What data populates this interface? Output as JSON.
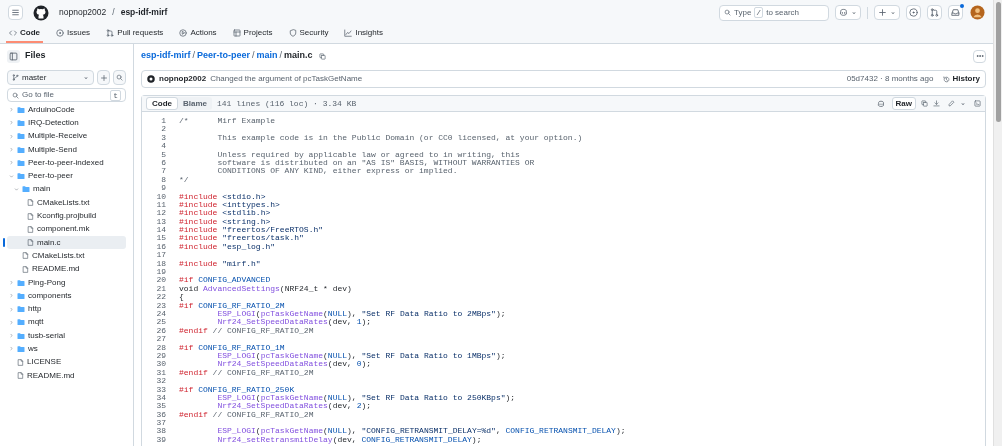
{
  "header": {
    "owner": "nopnop2002",
    "separator": "/",
    "repo": "esp-idf-mirf",
    "search": {
      "placeholder_before": "Type",
      "key": "/",
      "placeholder_after": "to search"
    },
    "inbox_unread": true
  },
  "tabs": [
    {
      "label": "Code",
      "selected": true
    },
    {
      "label": "Issues",
      "selected": false
    },
    {
      "label": "Pull requests",
      "selected": false
    },
    {
      "label": "Actions",
      "selected": false
    },
    {
      "label": "Projects",
      "selected": false
    },
    {
      "label": "Security",
      "selected": false
    },
    {
      "label": "Insights",
      "selected": false
    }
  ],
  "sidebar": {
    "title": "Files",
    "branch": "master",
    "go_to_file": {
      "placeholder": "Go to file",
      "shortcut": "t"
    },
    "tree": [
      {
        "name": "ArduinoCode",
        "kind": "folder",
        "expanded": false,
        "selected": false
      },
      {
        "name": "IRQ-Detection",
        "kind": "folder",
        "expanded": false,
        "selected": false
      },
      {
        "name": "Multiple-Receive",
        "kind": "folder",
        "expanded": false,
        "selected": false
      },
      {
        "name": "Multiple-Send",
        "kind": "folder",
        "expanded": false,
        "selected": false
      },
      {
        "name": "Peer-to-peer-indexed",
        "kind": "folder",
        "expanded": false,
        "selected": false
      },
      {
        "name": "Peer-to-peer",
        "kind": "folder",
        "expanded": true,
        "selected": false,
        "children": [
          {
            "name": "main",
            "kind": "folder",
            "expanded": true,
            "selected": false,
            "children": [
              {
                "name": "CMakeLists.txt",
                "kind": "file",
                "selected": false
              },
              {
                "name": "Kconfig.projbuild",
                "kind": "file",
                "selected": false
              },
              {
                "name": "component.mk",
                "kind": "file",
                "selected": false
              },
              {
                "name": "main.c",
                "kind": "file",
                "selected": true
              }
            ]
          },
          {
            "name": "CMakeLists.txt",
            "kind": "file",
            "selected": false
          },
          {
            "name": "README.md",
            "kind": "file",
            "selected": false
          }
        ]
      },
      {
        "name": "Ping-Pong",
        "kind": "folder",
        "expanded": false,
        "selected": false
      },
      {
        "name": "components",
        "kind": "folder",
        "expanded": false,
        "selected": false
      },
      {
        "name": "http",
        "kind": "folder",
        "expanded": false,
        "selected": false
      },
      {
        "name": "mqtt",
        "kind": "folder",
        "expanded": false,
        "selected": false
      },
      {
        "name": "tusb-serial",
        "kind": "folder",
        "expanded": false,
        "selected": false
      },
      {
        "name": "ws",
        "kind": "folder",
        "expanded": false,
        "selected": false
      },
      {
        "name": "LICENSE",
        "kind": "file",
        "selected": false
      },
      {
        "name": "README.md",
        "kind": "file",
        "selected": false
      }
    ]
  },
  "breadcrumb": [
    {
      "text": "esp-idf-mirf",
      "kind": "link"
    },
    {
      "text": "/",
      "kind": "separator"
    },
    {
      "text": "Peer-to-peer",
      "kind": "link"
    },
    {
      "text": "/",
      "kind": "separator"
    },
    {
      "text": "main",
      "kind": "link"
    },
    {
      "text": "/",
      "kind": "separator"
    },
    {
      "text": "main.c",
      "kind": "current"
    }
  ],
  "commit": {
    "author": "nopnop2002",
    "message": "Changed the argument of pcTaskGetName",
    "sha_time": "05d7432 · 8 months ago",
    "history": "History"
  },
  "file": {
    "views": [
      {
        "label": "Code",
        "selected": true
      },
      {
        "label": "Blame",
        "selected": false
      }
    ],
    "info": "141 lines (116 loc) · 3.34 KB",
    "raw": "Raw"
  },
  "code": [
    {
      "number": "1",
      "tokens": [
        {
          "kind": "comment",
          "text": "/*\tMirf Example"
        }
      ]
    },
    {
      "number": "2"
    },
    {
      "number": "3",
      "tokens": [
        {
          "kind": "comment",
          "text": "\tThis example code is in the Public Domain (or CC0 licensed, at your option.)"
        }
      ]
    },
    {
      "number": "4"
    },
    {
      "number": "5",
      "tokens": [
        {
          "kind": "comment",
          "text": "\tUnless required by applicable law or agreed to in writing, this"
        }
      ]
    },
    {
      "number": "6",
      "tokens": [
        {
          "kind": "comment",
          "text": "\tsoftware is distributed on an \"AS IS\" BASIS, WITHOUT WARRANTIES OR"
        }
      ]
    },
    {
      "number": "7",
      "tokens": [
        {
          "kind": "comment",
          "text": "\tCONDITIONS OF ANY KIND, either express or implied."
        }
      ]
    },
    {
      "number": "8",
      "tokens": [
        {
          "kind": "comment",
          "text": "*/"
        }
      ]
    },
    {
      "number": "9"
    },
    {
      "number": "10",
      "tokens": [
        {
          "kind": "keyword",
          "text": "#include "
        },
        {
          "kind": "string",
          "text": "<stdio.h>"
        }
      ]
    },
    {
      "number": "11",
      "tokens": [
        {
          "kind": "keyword",
          "text": "#include "
        },
        {
          "kind": "string",
          "text": "<inttypes.h>"
        }
      ]
    },
    {
      "number": "12",
      "tokens": [
        {
          "kind": "keyword",
          "text": "#include "
        },
        {
          "kind": "string",
          "text": "<stdlib.h>"
        }
      ]
    },
    {
      "number": "13",
      "tokens": [
        {
          "kind": "keyword",
          "text": "#include "
        },
        {
          "kind": "string",
          "text": "<string.h>"
        }
      ]
    },
    {
      "number": "14",
      "tokens": [
        {
          "kind": "keyword",
          "text": "#include "
        },
        {
          "kind": "string",
          "text": "\"freertos/FreeRTOS.h\""
        }
      ]
    },
    {
      "number": "15",
      "tokens": [
        {
          "kind": "keyword",
          "text": "#include "
        },
        {
          "kind": "string",
          "text": "\"freertos/task.h\""
        }
      ]
    },
    {
      "number": "16",
      "tokens": [
        {
          "kind": "keyword",
          "text": "#include "
        },
        {
          "kind": "string",
          "text": "\"esp_log.h\""
        }
      ]
    },
    {
      "number": "17"
    },
    {
      "number": "18",
      "tokens": [
        {
          "kind": "keyword",
          "text": "#include "
        },
        {
          "kind": "string",
          "text": "\"mirf.h\""
        }
      ]
    },
    {
      "number": "19"
    },
    {
      "number": "20",
      "tokens": [
        {
          "kind": "keyword",
          "text": "#if "
        },
        {
          "kind": "constant",
          "text": "CONFIG_ADVANCED"
        }
      ]
    },
    {
      "number": "21",
      "tokens": [
        {
          "kind": "plain",
          "text": "void "
        },
        {
          "kind": "function",
          "text": "AdvancedSettings"
        },
        {
          "kind": "plain",
          "text": "(NRF24_t * dev)"
        }
      ]
    },
    {
      "number": "22",
      "tokens": [
        {
          "kind": "plain",
          "text": "{"
        }
      ]
    },
    {
      "number": "23",
      "tokens": [
        {
          "kind": "keyword",
          "text": "#if "
        },
        {
          "kind": "constant",
          "text": "CONFIG_RF_RATIO_2M"
        }
      ]
    },
    {
      "number": "24",
      "tokens": [
        {
          "kind": "function",
          "text": "\tESP_LOGI"
        },
        {
          "kind": "plain",
          "text": "("
        },
        {
          "kind": "function",
          "text": "pcTaskGetName"
        },
        {
          "kind": "plain",
          "text": "("
        },
        {
          "kind": "constant",
          "text": "NULL"
        },
        {
          "kind": "plain",
          "text": "), "
        },
        {
          "kind": "string",
          "text": "\"Set RF Data Ratio to 2MBps\""
        },
        {
          "kind": "plain",
          "text": ");"
        }
      ]
    },
    {
      "number": "25",
      "tokens": [
        {
          "kind": "function",
          "text": "\tNrf24_SetSpeedDataRates"
        },
        {
          "kind": "plain",
          "text": "(dev, "
        },
        {
          "kind": "constant",
          "text": "1"
        },
        {
          "kind": "plain",
          "text": ");"
        }
      ]
    },
    {
      "number": "26",
      "tokens": [
        {
          "kind": "keyword",
          "text": "#endif "
        },
        {
          "kind": "comment",
          "text": "// CONFIG_RF_RATIO_2M"
        }
      ]
    },
    {
      "number": "27"
    },
    {
      "number": "28",
      "tokens": [
        {
          "kind": "keyword",
          "text": "#if "
        },
        {
          "kind": "constant",
          "text": "CONFIG_RF_RATIO_1M"
        }
      ]
    },
    {
      "number": "29",
      "tokens": [
        {
          "kind": "function",
          "text": "\tESP_LOGI"
        },
        {
          "kind": "plain",
          "text": "("
        },
        {
          "kind": "function",
          "text": "pcTaskGetName"
        },
        {
          "kind": "plain",
          "text": "("
        },
        {
          "kind": "constant",
          "text": "NULL"
        },
        {
          "kind": "plain",
          "text": "), "
        },
        {
          "kind": "string",
          "text": "\"Set RF Data Ratio to 1MBps\""
        },
        {
          "kind": "plain",
          "text": ");"
        }
      ]
    },
    {
      "number": "30",
      "tokens": [
        {
          "kind": "function",
          "text": "\tNrf24_SetSpeedDataRates"
        },
        {
          "kind": "plain",
          "text": "(dev, "
        },
        {
          "kind": "constant",
          "text": "0"
        },
        {
          "kind": "plain",
          "text": ");"
        }
      ]
    },
    {
      "number": "31",
      "tokens": [
        {
          "kind": "keyword",
          "text": "#endif "
        },
        {
          "kind": "comment",
          "text": "// CONFIG_RF_RATIO_2M"
        }
      ]
    },
    {
      "number": "32"
    },
    {
      "number": "33",
      "tokens": [
        {
          "kind": "keyword",
          "text": "#if "
        },
        {
          "kind": "constant",
          "text": "CONFIG_RF_RATIO_250K"
        }
      ]
    },
    {
      "number": "34",
      "tokens": [
        {
          "kind": "function",
          "text": "\tESP_LOGI"
        },
        {
          "kind": "plain",
          "text": "("
        },
        {
          "kind": "function",
          "text": "pcTaskGetName"
        },
        {
          "kind": "plain",
          "text": "("
        },
        {
          "kind": "constant",
          "text": "NULL"
        },
        {
          "kind": "plain",
          "text": "), "
        },
        {
          "kind": "string",
          "text": "\"Set RF Data Ratio to 250KBps\""
        },
        {
          "kind": "plain",
          "text": ");"
        }
      ]
    },
    {
      "number": "35",
      "tokens": [
        {
          "kind": "function",
          "text": "\tNrf24_SetSpeedDataRates"
        },
        {
          "kind": "plain",
          "text": "(dev, "
        },
        {
          "kind": "constant",
          "text": "2"
        },
        {
          "kind": "plain",
          "text": ");"
        }
      ]
    },
    {
      "number": "36",
      "tokens": [
        {
          "kind": "keyword",
          "text": "#endif "
        },
        {
          "kind": "comment",
          "text": "// CONFIG_RF_RATIO_2M"
        }
      ]
    },
    {
      "number": "37"
    },
    {
      "number": "38",
      "tokens": [
        {
          "kind": "function",
          "text": "\tESP_LOGI"
        },
        {
          "kind": "plain",
          "text": "("
        },
        {
          "kind": "function",
          "text": "pcTaskGetName"
        },
        {
          "kind": "plain",
          "text": "("
        },
        {
          "kind": "constant",
          "text": "NULL"
        },
        {
          "kind": "plain",
          "text": "), "
        },
        {
          "kind": "string",
          "text": "\"CONFIG_RETRANSMIT_DELAY=%d\""
        },
        {
          "kind": "plain",
          "text": ", "
        },
        {
          "kind": "constant",
          "text": "CONFIG_RETRANSMIT_DELAY"
        },
        {
          "kind": "plain",
          "text": ");"
        }
      ]
    },
    {
      "number": "39",
      "tokens": [
        {
          "kind": "function",
          "text": "\tNrf24_setRetransmitDelay"
        },
        {
          "kind": "plain",
          "text": "(dev, "
        },
        {
          "kind": "constant",
          "text": "CONFIG_RETRANSMIT_DELAY"
        },
        {
          "kind": "plain",
          "text": ");"
        }
      ]
    }
  ]
}
